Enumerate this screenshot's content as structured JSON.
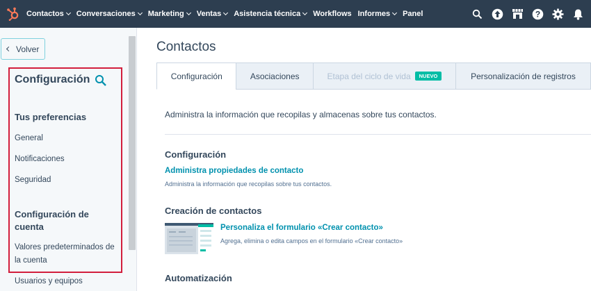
{
  "topnav": {
    "items": [
      {
        "label": "Contactos",
        "dropdown": true
      },
      {
        "label": "Conversaciones",
        "dropdown": true
      },
      {
        "label": "Marketing",
        "dropdown": true
      },
      {
        "label": "Ventas",
        "dropdown": true
      },
      {
        "label": "Asistencia técnica",
        "dropdown": true
      },
      {
        "label": "Workflows",
        "dropdown": false
      },
      {
        "label": "Informes",
        "dropdown": true
      },
      {
        "label": "Panel",
        "dropdown": false
      }
    ],
    "icons": [
      "search-icon",
      "upgrade-icon",
      "marketplace-icon",
      "help-icon",
      "settings-icon",
      "notifications-icon"
    ]
  },
  "sidebar": {
    "back_label": "Volver",
    "title": "Configuración",
    "sections": [
      {
        "title": "Tus preferencias",
        "items": [
          "General",
          "Notificaciones",
          "Seguridad"
        ]
      },
      {
        "title": "Configuración de cuenta",
        "items": [
          "Valores predeterminados de la cuenta",
          "Usuarios y equipos"
        ]
      }
    ]
  },
  "main": {
    "title": "Contactos",
    "tabs": [
      {
        "label": "Configuración",
        "state": "active"
      },
      {
        "label": "Asociaciones",
        "state": "normal"
      },
      {
        "label": "Etapa del ciclo de vida",
        "state": "disabled",
        "badge": "NUEVO"
      },
      {
        "label": "Personalización de registros",
        "state": "normal"
      }
    ],
    "intro": "Administra la información que recopilas y almacenas sobre tus contactos.",
    "sections": [
      {
        "heading": "Configuración",
        "link": "Administra propiedades de contacto",
        "description": "Administra la información que recopilas sobre tus contactos."
      },
      {
        "heading": "Creación de contactos",
        "link": "Personaliza el formulario «Crear contacto»",
        "description": "Agrega, elimina o edita campos en el formulario «Crear contacto»"
      },
      {
        "heading": "Automatización"
      }
    ]
  },
  "colors": {
    "nav_bg": "#2d3e50",
    "accent": "#0091ae",
    "badge": "#00bda5",
    "highlight": "#d21e3c"
  }
}
